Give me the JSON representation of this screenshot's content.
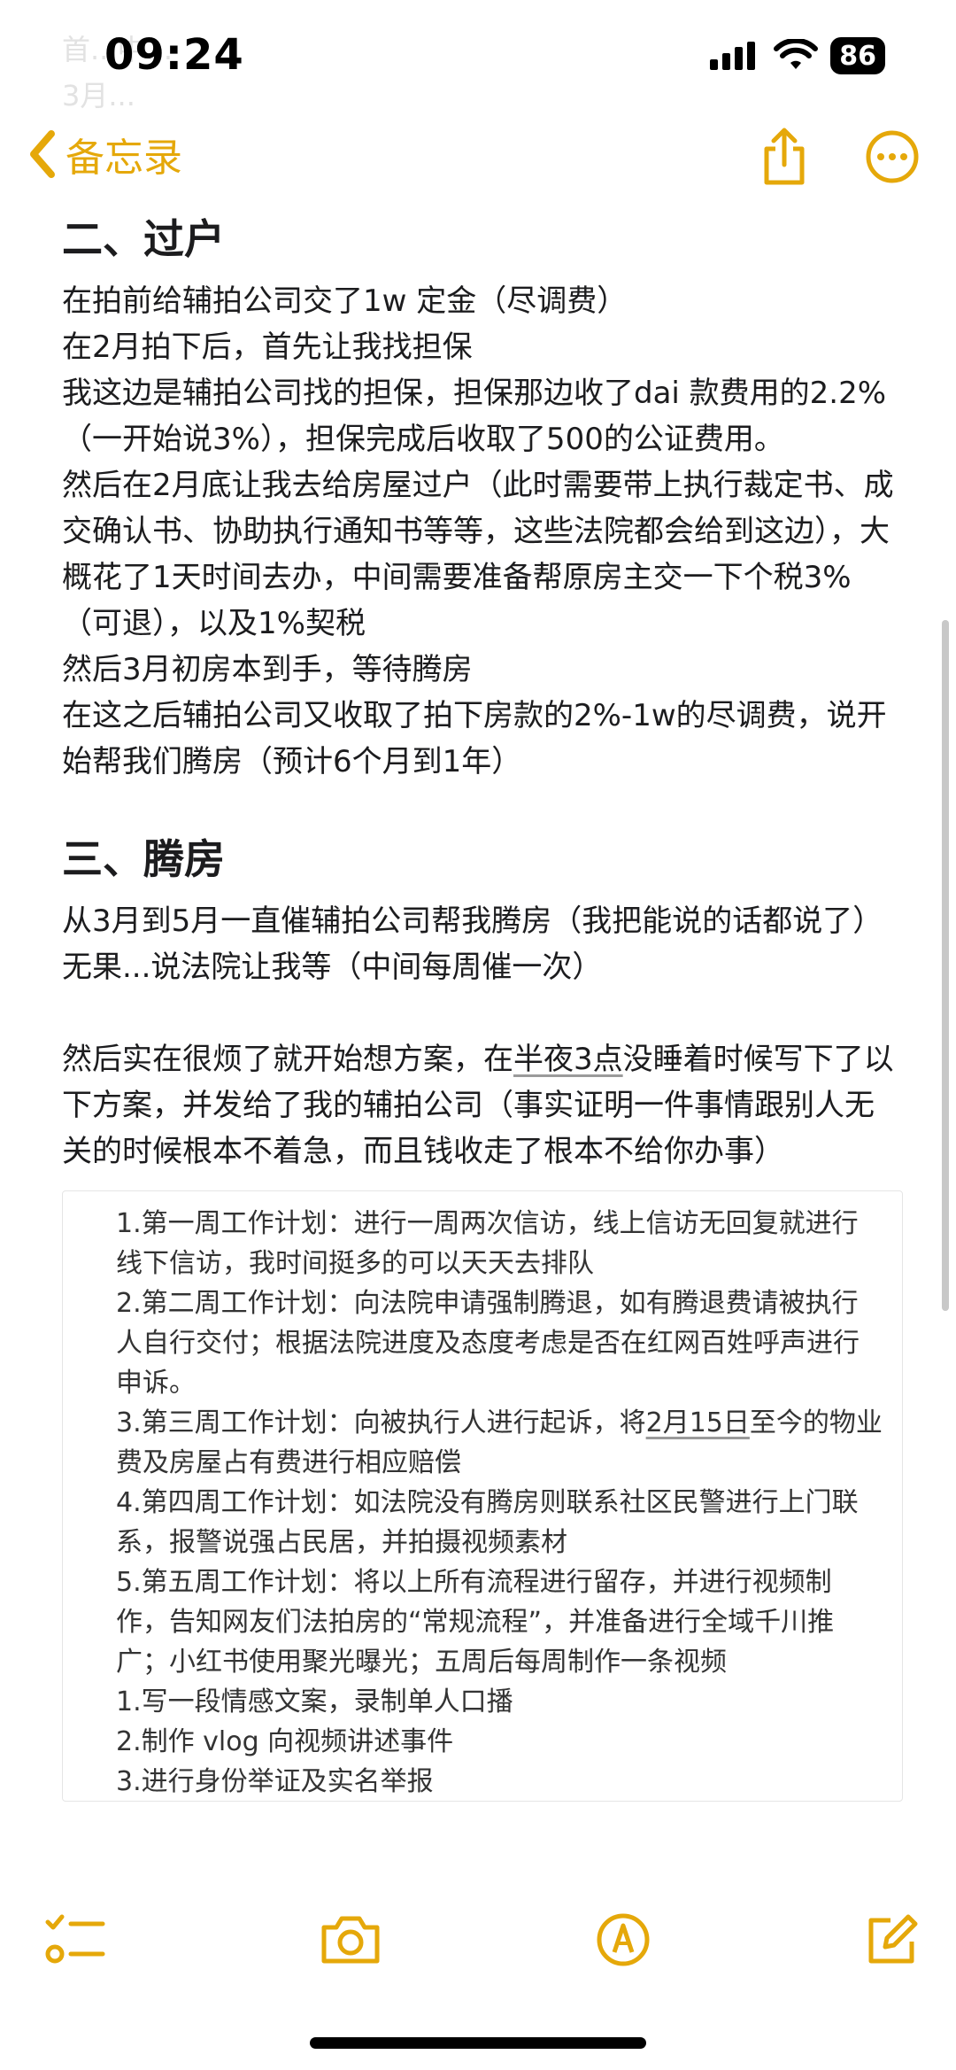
{
  "status": {
    "time": "09:24",
    "battery": "86"
  },
  "faded_top": [
    "首...中...",
    "3月..."
  ],
  "nav": {
    "back_label": "备忘录"
  },
  "sections": [
    {
      "heading": "二、过户",
      "lines": [
        "在拍前给辅拍公司交了1w 定金（尽调费）",
        "在2月拍下后，首先让我找担保",
        "我这边是辅拍公司找的担保，担保那边收了dai 款费用的2.2%（一开始说3%），担保完成后收取了500的公证费用。",
        "然后在2月底让我去给房屋过户（此时需要带上执行裁定书、成交确认书、协助执行通知书等等，这些法院都会给到这边），大概花了1天时间去办，中间需要准备帮原房主交一下个税3%（可退），以及1%契税",
        "然后3月初房本到手，等待腾房",
        "在这之后辅拍公司又收取了拍下房款的2%-1w的尽调费，说开始帮我们腾房（预计6个月到1年）"
      ]
    },
    {
      "heading": "三、腾房",
      "lines": [
        "从3月到5月一直催辅拍公司帮我腾房（我把能说的话都说了） 无果...说法院让我等（中间每周催一次）"
      ]
    }
  ],
  "para2_pre": "然后实在很烦了就开始想方案，在",
  "para2_ul": "半夜3点",
  "para2_post": "没睡着时候写下了以下方案，并发给了我的辅拍公司（事实证明一件事情跟别人无关的时候根本不着急，而且钱收走了根本不给你办事）",
  "plan": {
    "l1": "1.第一周工作计划：进行一周两次信访，线上信访无回复就进行线下信访，我时间挺多的可以天天去排队",
    "l2": "2.第二周工作计划：向法院申请强制腾退，如有腾退费请被执行人自行交付；根据法院进度及态度考虑是否在红网百姓呼声进行申诉。",
    "l3_pre": "3.第三周工作计划：向被执行人进行起诉，将",
    "l3_ul": "2月15日",
    "l3_post": "至今的物业费及房屋占有费进行相应赔偿",
    "l4": "4.第四周工作计划：如法院没有腾房则联系社区民警进行上门联系，报警说强占民居，并拍摄视频素材",
    "l5": "5.第五周工作计划：将以上所有流程进行留存，并进行视频制作，告知网友们法拍房的“常规流程”，并准备进行全域千川推广；小红书使用聚光曝光；五周后每周制作一条视频",
    "l6": "1.写一段情感文案，录制单人口播",
    "l7": "2.制作 vlog 向视频讲述事件",
    "l8": "3.进行身份举证及实名举报"
  },
  "colors": {
    "accent": "#e5a80a",
    "text": "#1c1c1e"
  }
}
